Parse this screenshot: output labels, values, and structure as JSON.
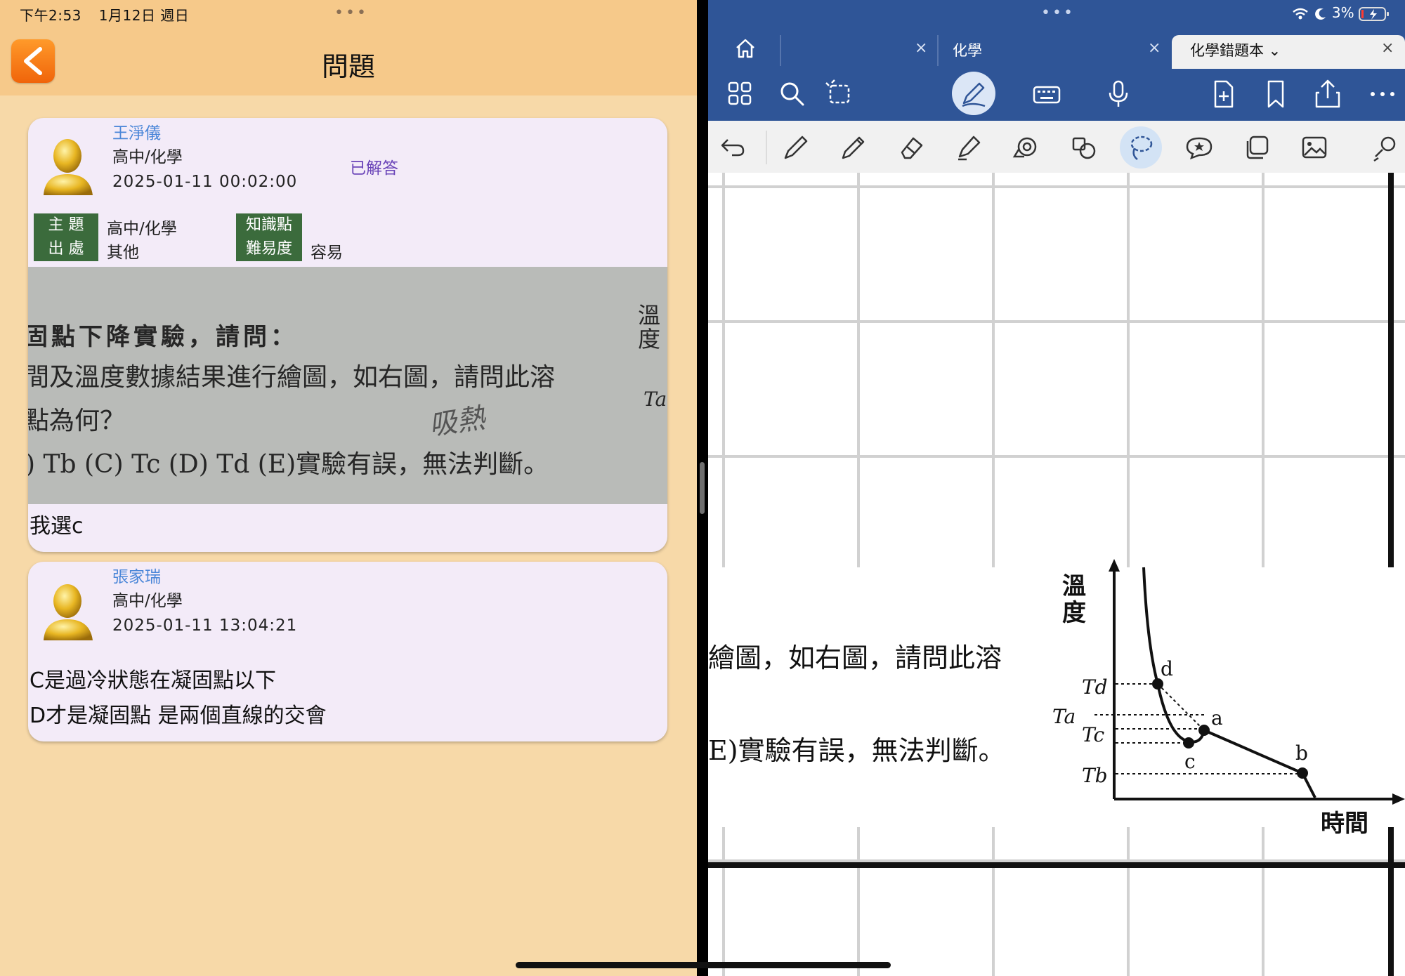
{
  "left": {
    "status": {
      "time": "下午2:53",
      "date": "1月12日 週日"
    },
    "title": "問題",
    "question": {
      "user": "王淨儀",
      "subject": "高中/化學",
      "datetime": "2025-01-11 00:02:00",
      "status": "已解答",
      "tags": [
        {
          "label": "主 題",
          "value": "高中/化學"
        },
        {
          "label": "出 處",
          "value": "其他"
        },
        {
          "label": "知識點",
          "value": ""
        },
        {
          "label": "難易度",
          "value": "容易"
        }
      ],
      "image_text": {
        "line1": "固點下降實驗，請問：",
        "line2": "間及溫度數據結果進行繪圖，如右圖，請問此溶",
        "line3": "點為何？",
        "line4": ") Tb  (C) Tc  (D) Td  (E)實驗有誤，無法判斷。",
        "side1": "溫",
        "side2": "度",
        "side3": "Ta",
        "handwriting": "吸熱"
      },
      "answer": "我選c"
    },
    "reply": {
      "user": "張家瑞",
      "subject": "高中/化學",
      "datetime": "2025-01-11 13:04:21",
      "lines": [
        "C是過冷狀態在凝固點以下",
        "D才是凝固點 是兩個直線的交會"
      ]
    }
  },
  "right": {
    "status": {
      "battery": "3%"
    },
    "tabs": [
      {
        "label": "",
        "close": "×"
      },
      {
        "label": "化學",
        "close": "×"
      },
      {
        "label": "化學錯題本 ⌄",
        "close": "×"
      }
    ],
    "snippet": {
      "line1": "繪圖，如右圖，請問此溶",
      "line2": "E)實驗有誤，無法判斷。",
      "ylabel1": "溫",
      "ylabel2": "度",
      "xlabel": "時間",
      "tick_d": "Td",
      "tick_a": "Ta",
      "tick_c": "Tc",
      "tick_b": "Tb",
      "pt_d": "d",
      "pt_a": "a",
      "pt_c": "c",
      "pt_b": "b"
    }
  }
}
